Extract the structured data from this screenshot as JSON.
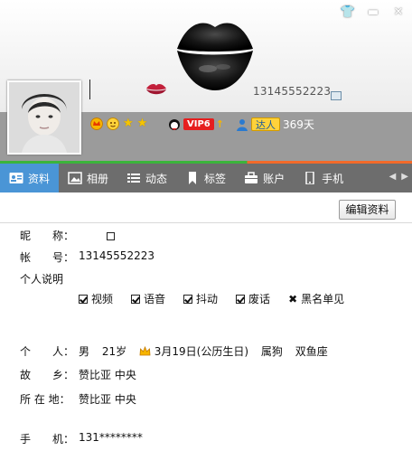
{
  "header": {
    "qq_number": "13145552223",
    "title_buttons": [
      "shirt-icon",
      "minimize-icon",
      "close-icon"
    ]
  },
  "badges": {
    "vip_label": "VIP6",
    "daren_label": "达人",
    "daren_days": "369天"
  },
  "tabs": [
    {
      "label": "资料",
      "icon": "profile-card-icon",
      "active": true
    },
    {
      "label": "相册",
      "icon": "album-icon"
    },
    {
      "label": "动态",
      "icon": "feed-icon"
    },
    {
      "label": "标签",
      "icon": "bookmark-icon"
    },
    {
      "label": "账户",
      "icon": "wallet-icon"
    },
    {
      "label": "手机",
      "icon": "phone-icon"
    }
  ],
  "toolbar": {
    "edit_label": "编辑资料"
  },
  "profile": {
    "nickname_label": "昵　　称：",
    "account_label": "帐　　号：",
    "account_value": "13145552223",
    "desc_label": "个人说明",
    "tags": [
      "视频",
      "语音",
      "抖动",
      "废话",
      "黑名单见"
    ],
    "person_label": "个　　人：",
    "gender": "男",
    "age": "21岁",
    "birthday": "3月19日(公历生日)",
    "zodiac": "属狗",
    "constellation": "双鱼座",
    "hometown_label": "故　　乡：",
    "hometown": "赞比亚 中央",
    "location_label": "所 在 地：",
    "location": "赞比亚 中央",
    "phone_label": "手　　机：",
    "phone": "131********"
  },
  "colors": {
    "tab_active": "#4a95d6",
    "tab_bar": "#6d6d6d",
    "strip": "#9b9b9b",
    "vip_red": "#e61e1e"
  }
}
